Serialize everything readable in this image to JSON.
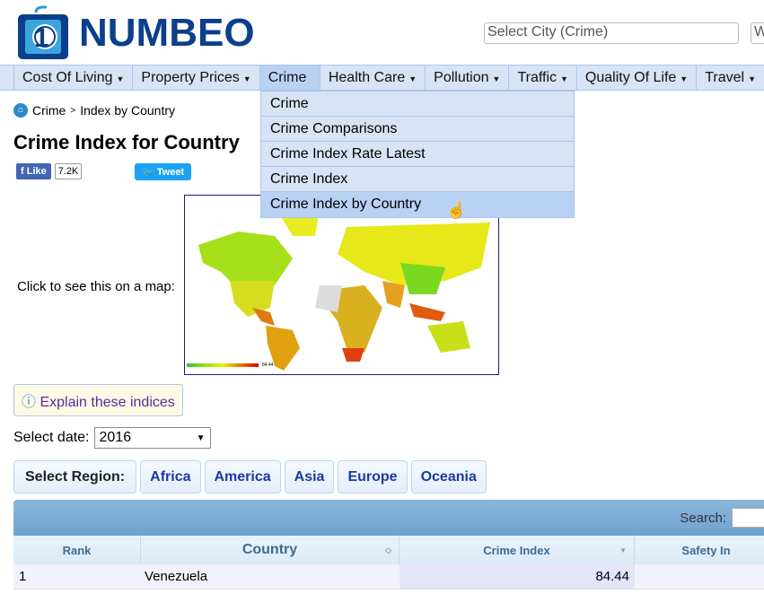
{
  "logo": {
    "text": "NUMBEO"
  },
  "search": {
    "city_placeholder": "Select City (Crime)",
    "second_placeholder": "W"
  },
  "nav": [
    {
      "label": "Cost Of Living"
    },
    {
      "label": "Property Prices"
    },
    {
      "label": "Crime"
    },
    {
      "label": "Health Care"
    },
    {
      "label": "Pollution"
    },
    {
      "label": "Traffic"
    },
    {
      "label": "Quality Of Life"
    },
    {
      "label": "Travel"
    }
  ],
  "dropdown": [
    "Crime",
    "Crime Comparisons",
    "Crime Index Rate Latest",
    "Crime Index",
    "Crime Index by Country"
  ],
  "breadcrumb": {
    "crime": "Crime",
    "sep": ">",
    "current": "Index by Country"
  },
  "title": "Crime Index for Country",
  "social": {
    "like": "Like",
    "like_count": "7.2K",
    "tweet": "Tweet"
  },
  "map": {
    "label": "Click to see this on a map:",
    "legend_max": "84.44"
  },
  "explain": "Explain these indices",
  "date": {
    "label": "Select date:",
    "value": "2016"
  },
  "regions": {
    "label": "Select Region:",
    "items": [
      "Africa",
      "America",
      "Asia",
      "Europe",
      "Oceania"
    ]
  },
  "table": {
    "search_label": "Search:",
    "headers": [
      "Rank",
      "Country",
      "Crime Index",
      "Safety In"
    ],
    "rows": [
      {
        "rank": "1",
        "country": "Venezuela",
        "crime_index": "84.44"
      }
    ]
  }
}
